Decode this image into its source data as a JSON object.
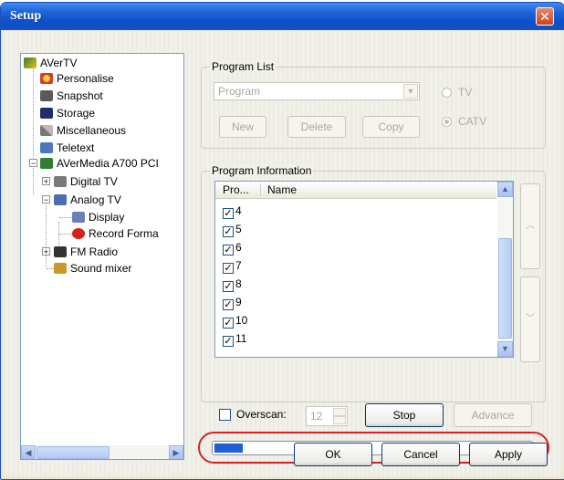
{
  "window": {
    "title": "Setup"
  },
  "tree": {
    "root": "AVerTV",
    "items": [
      "Personalise",
      "Snapshot",
      "Storage",
      "Miscellaneous",
      "Teletext"
    ],
    "device": "AVerMedia A700 PCI",
    "device_children": [
      "Digital TV",
      "Analog TV",
      "FM Radio",
      "Sound mixer"
    ],
    "analog_children": [
      "Display",
      "Record Forma"
    ]
  },
  "program_list": {
    "legend": "Program List",
    "select_value": "Program",
    "new_label": "New",
    "delete_label": "Delete",
    "copy_label": "Copy",
    "radio_tv": "TV",
    "radio_catv": "CATV",
    "selected_source": "CATV"
  },
  "program_info": {
    "legend": "Program Information",
    "columns": [
      "Pro...",
      "Name"
    ],
    "rows": [
      {
        "number": "4",
        "checked": true
      },
      {
        "number": "5",
        "checked": true
      },
      {
        "number": "6",
        "checked": true
      },
      {
        "number": "7",
        "checked": true
      },
      {
        "number": "8",
        "checked": true
      },
      {
        "number": "9",
        "checked": true
      },
      {
        "number": "10",
        "checked": true
      },
      {
        "number": "11",
        "checked": true
      }
    ],
    "overscan_label": "Overscan:",
    "overscan_value": "12",
    "stop_label": "Stop",
    "advance_label": "Advance"
  },
  "progress": {
    "value_percent": 9,
    "color": "#1e5fd6"
  },
  "highlight_color": "#d92020",
  "footer": {
    "ok_label": "OK",
    "cancel_label": "Cancel",
    "apply_label": "Apply"
  }
}
